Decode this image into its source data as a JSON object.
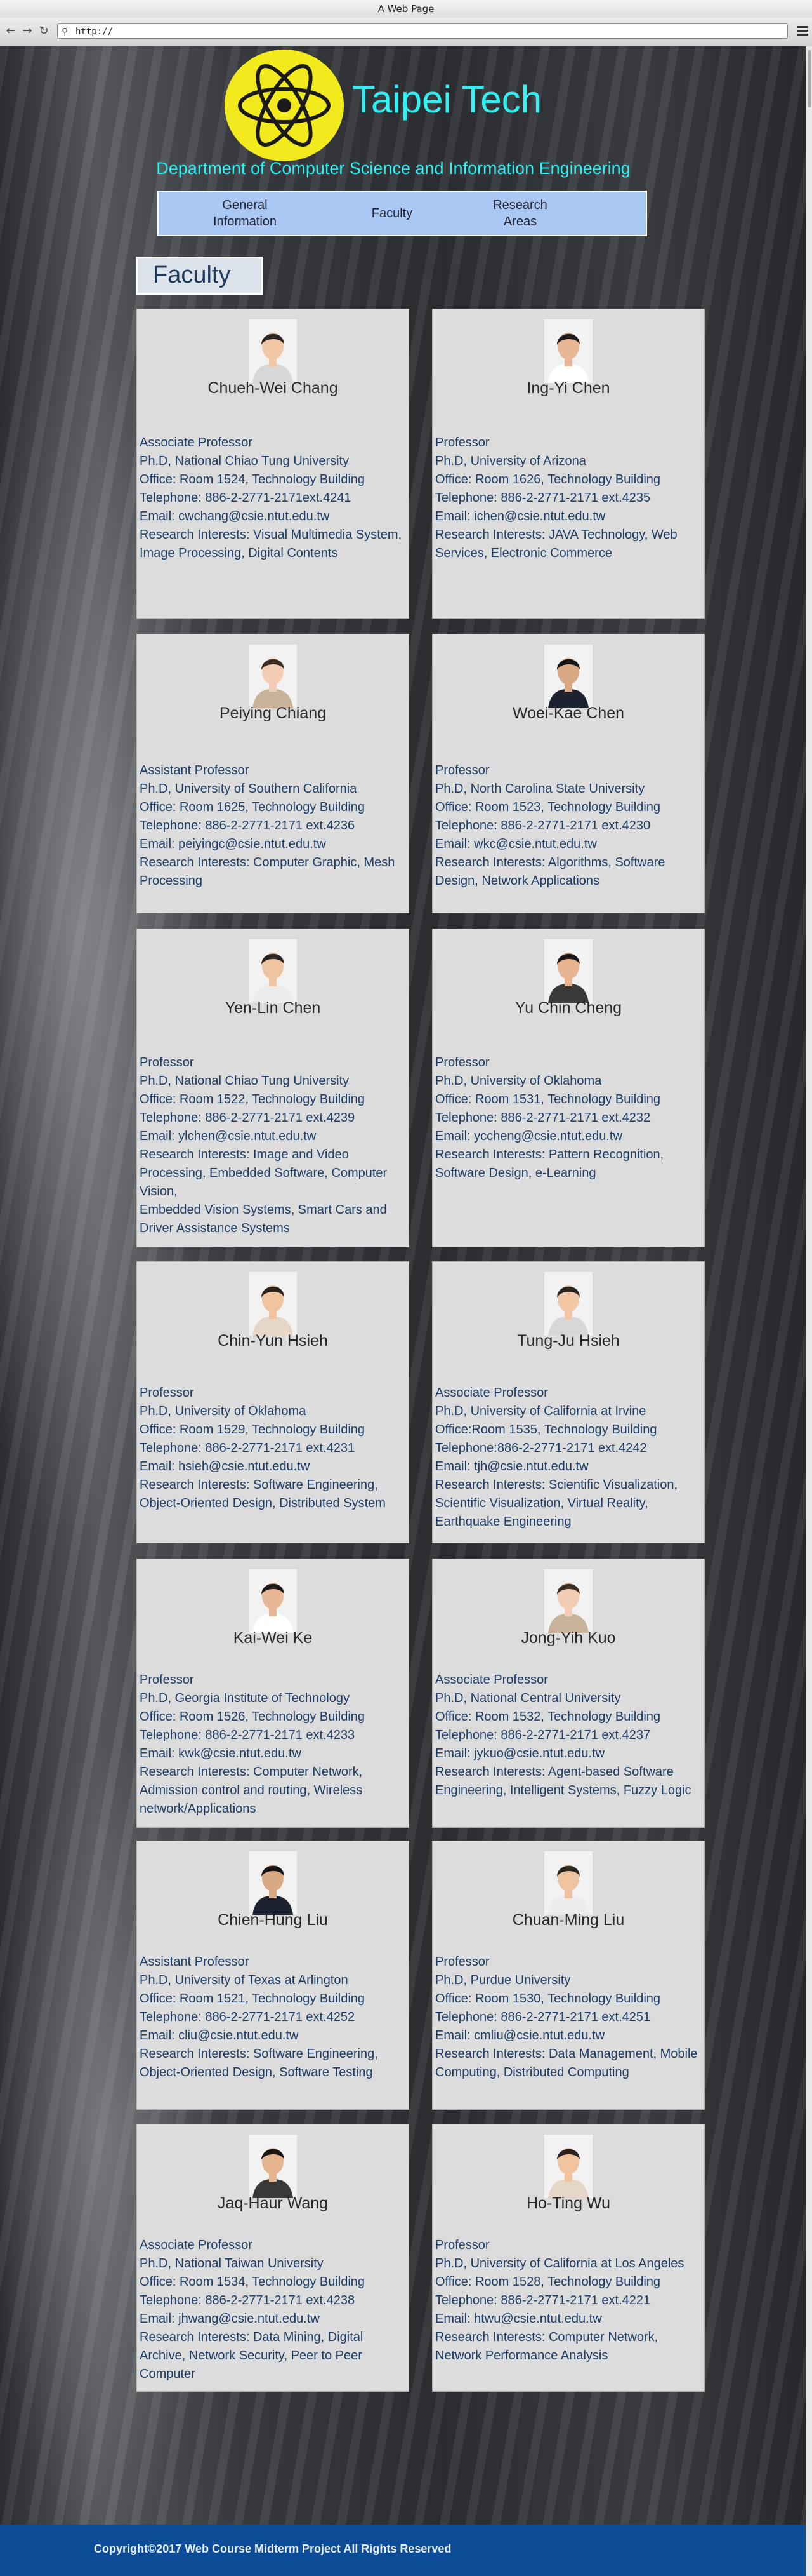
{
  "window": {
    "title": "A Web Page"
  },
  "browser": {
    "url": "http://"
  },
  "header": {
    "site_title": "Taipei Tech",
    "department": "Department of Computer Science and Information Engineering"
  },
  "nav": [
    {
      "label": "General\nInformation"
    },
    {
      "label": "Faculty"
    },
    {
      "label": "Research\nAreas"
    }
  ],
  "section_title": "Faculty",
  "faculty": [
    {
      "name": "Chueh-Wei Chang",
      "lines": [
        "Associate Professor",
        "Ph.D, National Chiao Tung University",
        "Office: Room 1524, Technology Building",
        "Telephone: 886-2-2771-2171ext.4241",
        "Email: cwchang@csie.ntut.edu.tw",
        "Research Interests: Visual Multimedia System, Image Processing, Digital Contents"
      ]
    },
    {
      "name": "Ing-Yi Chen",
      "lines": [
        "Professor",
        "Ph.D, University of Arizona",
        "Office: Room 1626, Technology Building",
        "Telephone: 886-2-2771-2171 ext.4235",
        "Email: ichen@csie.ntut.edu.tw",
        "Research Interests: JAVA Technology, Web Services, Electronic Commerce"
      ]
    },
    {
      "name": "Peiying Chiang",
      "lines": [
        "Assistant Professor",
        "Ph.D, University of Southern California",
        "Office: Room 1625, Technology Building",
        "Telephone: 886-2-2771-2171 ext.4236",
        "Email: peiyingc@csie.ntut.edu.tw",
        "Research Interests: Computer Graphic, Mesh Processing"
      ]
    },
    {
      "name": "Woei-Kae Chen",
      "lines": [
        "Professor",
        "Ph.D, North Carolina State University",
        "Office: Room 1523, Technology Building",
        "Telephone: 886-2-2771-2171 ext.4230",
        "Email: wkc@csie.ntut.edu.tw",
        "Research Interests: Algorithms, Software Design, Network Applications"
      ]
    },
    {
      "name": "Yen-Lin Chen",
      "lines": [
        "Professor",
        "Ph.D, National Chiao Tung University",
        "Office: Room 1522, Technology Building",
        "Telephone: 886-2-2771-2171 ext.4239",
        "Email: ylchen@csie.ntut.edu.tw",
        "Research Interests: Image and Video Processing, Embedded Software, Computer Vision,",
        "Embedded Vision Systems, Smart Cars and Driver Assistance Systems"
      ]
    },
    {
      "name": "Yu Chin Cheng",
      "lines": [
        "Professor",
        "Ph.D, University of Oklahoma",
        "Office: Room 1531, Technology Building",
        "Telephone: 886-2-2771-2171 ext.4232",
        "Email: yccheng@csie.ntut.edu.tw",
        "Research Interests: Pattern Recognition, Software Design, e-Learning"
      ]
    },
    {
      "name": "Chin-Yun Hsieh",
      "lines": [
        "Professor",
        "Ph.D, University of Oklahoma",
        "Office: Room 1529, Technology Building",
        "Telephone: 886-2-2771-2171 ext.4231",
        "Email: hsieh@csie.ntut.edu.tw",
        "Research Interests: Software Engineering, Object-Oriented Design, Distributed System"
      ]
    },
    {
      "name": "Tung-Ju Hsieh",
      "lines": [
        "Associate Professor",
        "Ph.D, University of California at Irvine",
        "Office:Room 1535, Technology Building",
        "Telephone:886-2-2771-2171 ext.4242",
        "Email: tjh@csie.ntut.edu.tw",
        "Research Interests: Scientific Visualization, Scientific Visualization, Virtual Reality, Earthquake Engineering"
      ]
    },
    {
      "name": "Kai-Wei Ke",
      "lines": [
        "Professor",
        "Ph.D, Georgia Institute of Technology",
        "Office: Room 1526, Technology Building",
        "Telephone: 886-2-2771-2171 ext.4233",
        "Email: kwk@csie.ntut.edu.tw",
        "Research Interests: Computer Network, Admission control and routing, Wireless network/Applications"
      ]
    },
    {
      "name": "Jong-Yih Kuo",
      "lines": [
        "Associate Professor",
        "Ph.D, National Central University",
        "Office: Room 1532, Technology Building",
        "Telephone: 886-2-2771-2171 ext.4237",
        "Email: jykuo@csie.ntut.edu.tw",
        "Research Interests: Agent-based Software Engineering, Intelligent Systems, Fuzzy Logic"
      ]
    },
    {
      "name": "Chien-Hung Liu",
      "lines": [
        "Assistant Professor",
        "Ph.D, University of Texas at Arlington",
        "Office: Room 1521, Technology Building",
        "Telephone: 886-2-2771-2171 ext.4252",
        "Email: cliu@csie.ntut.edu.tw",
        "Research Interests: Software Engineering, Object-Oriented Design, Software Testing"
      ]
    },
    {
      "name": "Chuan-Ming Liu",
      "lines": [
        "Professor",
        "Ph.D, Purdue University",
        "Office: Room 1530, Technology Building",
        "Telephone: 886-2-2771-2171 ext.4251",
        "Email: cmliu@csie.ntut.edu.tw",
        "Research Interests: Data Management, Mobile Computing, Distributed Computing"
      ]
    },
    {
      "name": "Jaq-Haur Wang",
      "lines": [
        "Associate Professor",
        "Ph.D, National Taiwan University",
        "Office: Room 1534, Technology Building",
        "Telephone: 886-2-2771-2171 ext.4238",
        "Email: jhwang@csie.ntut.edu.tw",
        "Research Interests: Data Mining, Digital Archive, Network Security, Peer to Peer Computer"
      ]
    },
    {
      "name": "Ho-Ting Wu",
      "lines": [
        "Professor",
        "Ph.D, University of California at Los Angeles",
        "Office: Room 1528, Technology Building",
        "Telephone: 886-2-2771-2171 ext.4221",
        "Email: htwu@csie.ntut.edu.tw",
        "Research Interests: Computer Network, Network Performance Analysis"
      ]
    }
  ],
  "footer": {
    "text": "Copyright©2017 Web Course Midterm Project  All Rights Reserved"
  }
}
